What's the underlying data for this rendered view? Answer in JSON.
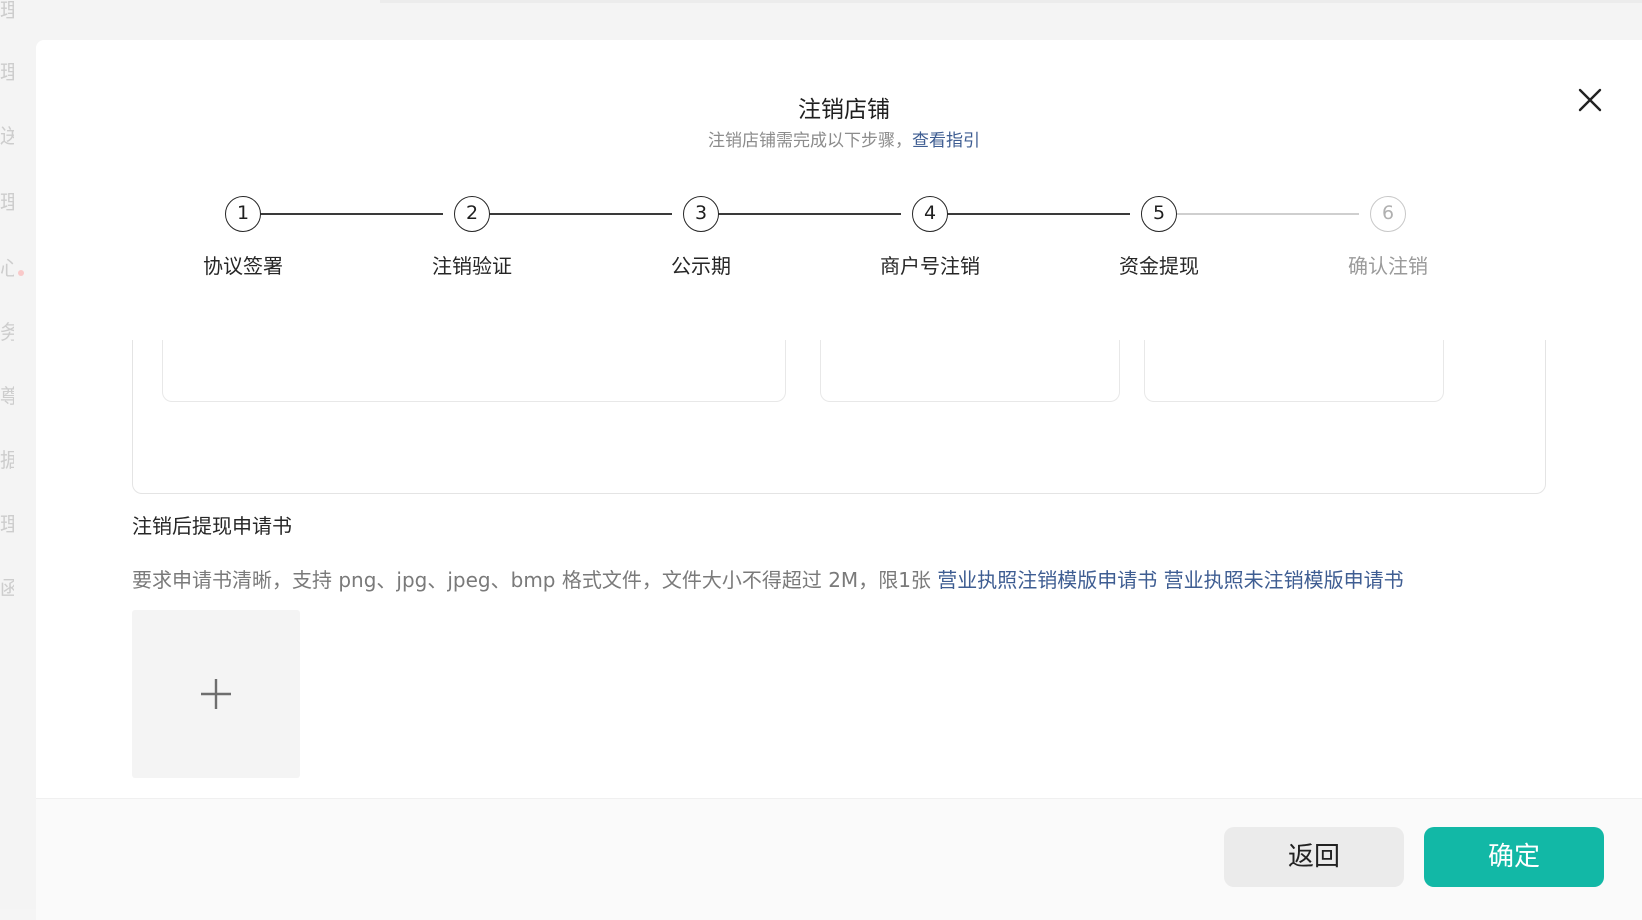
{
  "background": {
    "sidebar_glyphs": [
      "理",
      "理",
      "送",
      "理",
      "心",
      "务",
      "尊",
      "据",
      "理",
      "函"
    ]
  },
  "modal": {
    "title": "注销店铺",
    "subtitle_text": "注销店铺需完成以下步骤，",
    "subtitle_link": "查看指引",
    "close_icon": "close-icon"
  },
  "steps": [
    {
      "number": "1",
      "label": "协议签署",
      "active": true
    },
    {
      "number": "2",
      "label": "注销验证",
      "active": true
    },
    {
      "number": "3",
      "label": "公示期",
      "active": true
    },
    {
      "number": "4",
      "label": "商户号注销",
      "active": true
    },
    {
      "number": "5",
      "label": "资金提现",
      "active": true
    },
    {
      "number": "6",
      "label": "确认注销",
      "active": false
    }
  ],
  "upload_section": {
    "title": "注销后提现申请书",
    "description": "要求申请书清晰，支持 png、jpg、jpeg、bmp 格式文件，文件大小不得超过 2M，限1张",
    "template_link_1": "营业执照注销模版申请书",
    "template_link_2": "营业执照未注销模版申请书",
    "upload_icon": "plus-icon"
  },
  "footer": {
    "back_label": "返回",
    "confirm_label": "确定"
  },
  "colors": {
    "primary": "#12b8a6",
    "link": "#3e5d92",
    "inactive": "#b0b0b0"
  }
}
